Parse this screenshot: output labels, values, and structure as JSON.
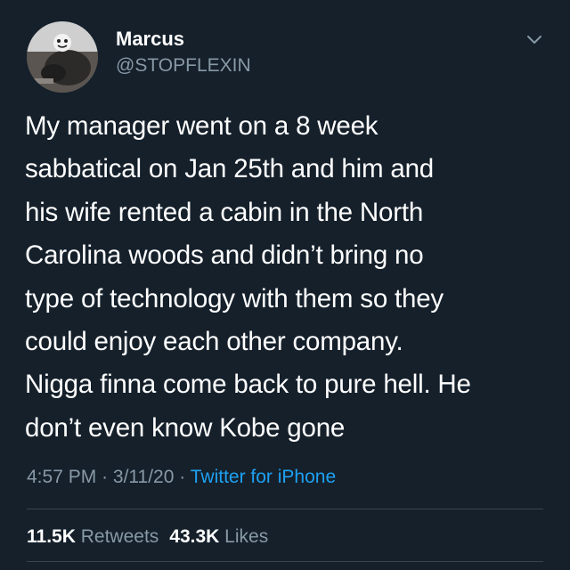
{
  "user": {
    "name": "Marcus",
    "handle": "@STOPFLEXIN",
    "avatar_icon": "profile-photo"
  },
  "tweet": {
    "text": "My manager went on a 8 week\nsabbatical on Jan 25th and him and\nhis wife rented a cabin in the North\nCarolina woods and didn’t bring no\ntype of technology with them so they\ncould enjoy each other company.\nNigga finna come back to pure hell. He\ndon’t even know Kobe gone",
    "time": "4:57 PM",
    "date": "3/11/20",
    "separator": "·",
    "source": "Twitter for iPhone"
  },
  "stats": {
    "retweets_count": "11.5K",
    "retweets_label": "Retweets",
    "likes_count": "43.3K",
    "likes_label": "Likes"
  },
  "icons": {
    "menu": "chevron-down-icon"
  },
  "colors": {
    "background": "#15202b",
    "text": "#ffffff",
    "secondary": "#8899a6",
    "link": "#1da1f2",
    "divider": "#38444d"
  }
}
